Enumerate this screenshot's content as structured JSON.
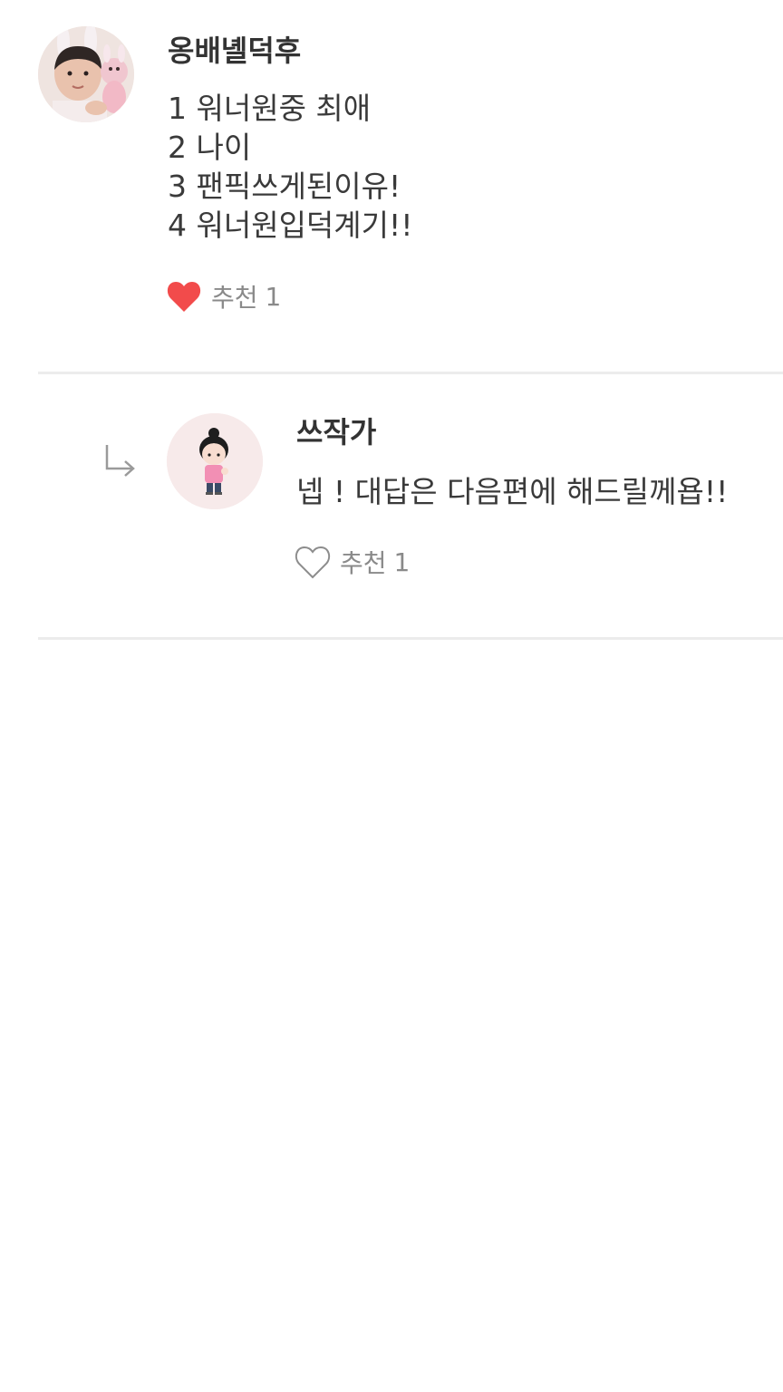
{
  "comments": [
    {
      "author": "옹배녤덕후",
      "lines": [
        "1 워너원중 최애",
        "2 나이",
        "3 팬픽쓰게된이유!",
        "4 워너원입덕계기!!"
      ],
      "like_label": "추천",
      "like_count": "1",
      "liked": true,
      "avatar_icon": "profile-photo"
    }
  ],
  "replies": [
    {
      "author": "쓰작가",
      "text": "넵 ! 대답은 다음편에 해드릴께욥!!",
      "like_label": "추천",
      "like_count": "1",
      "liked": false,
      "avatar_icon": "cartoon-character",
      "reply_icon": "reply-arrow-icon"
    }
  ],
  "colors": {
    "heart_filled": "#f24b4b",
    "heart_outline": "#8c8c8c",
    "divider": "#ececec",
    "muted_text": "#8a8a8a",
    "main_text": "#3a3a3a"
  }
}
